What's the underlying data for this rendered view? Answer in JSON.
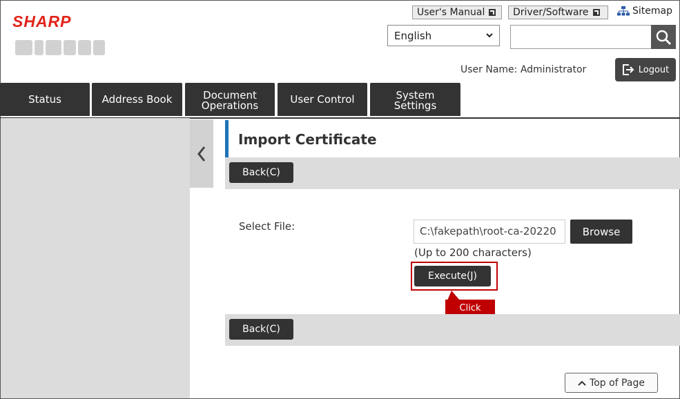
{
  "brand": {
    "logo": "SHARP"
  },
  "header": {
    "users_manual": "User's Manual",
    "driver_software": "Driver/Software",
    "sitemap": "Sitemap",
    "language": "English",
    "search_value": "",
    "user_label": "User Name: Administrator",
    "logout": "Logout"
  },
  "nav": {
    "tabs": [
      {
        "line1": "Status",
        "line2": ""
      },
      {
        "line1": "Address Book",
        "line2": ""
      },
      {
        "line1": "Document",
        "line2": "Operations"
      },
      {
        "line1": "User Control",
        "line2": ""
      },
      {
        "line1": "System",
        "line2": "Settings"
      }
    ]
  },
  "page": {
    "title": "Import Certificate",
    "back_top": "Back(C)",
    "back_bottom": "Back(C)",
    "select_file_label": "Select File:",
    "file_value": "C:\\fakepath\\root-ca-20220",
    "browse": "Browse",
    "hint": "(Up to 200 characters)",
    "execute": "Execute(J)",
    "callout": "Click",
    "top_of_page": "Top of Page"
  },
  "colors": {
    "brand_red": "#e2231a",
    "accent_blue": "#1f73b7",
    "highlight_red": "#c00000",
    "dark": "#333333"
  }
}
